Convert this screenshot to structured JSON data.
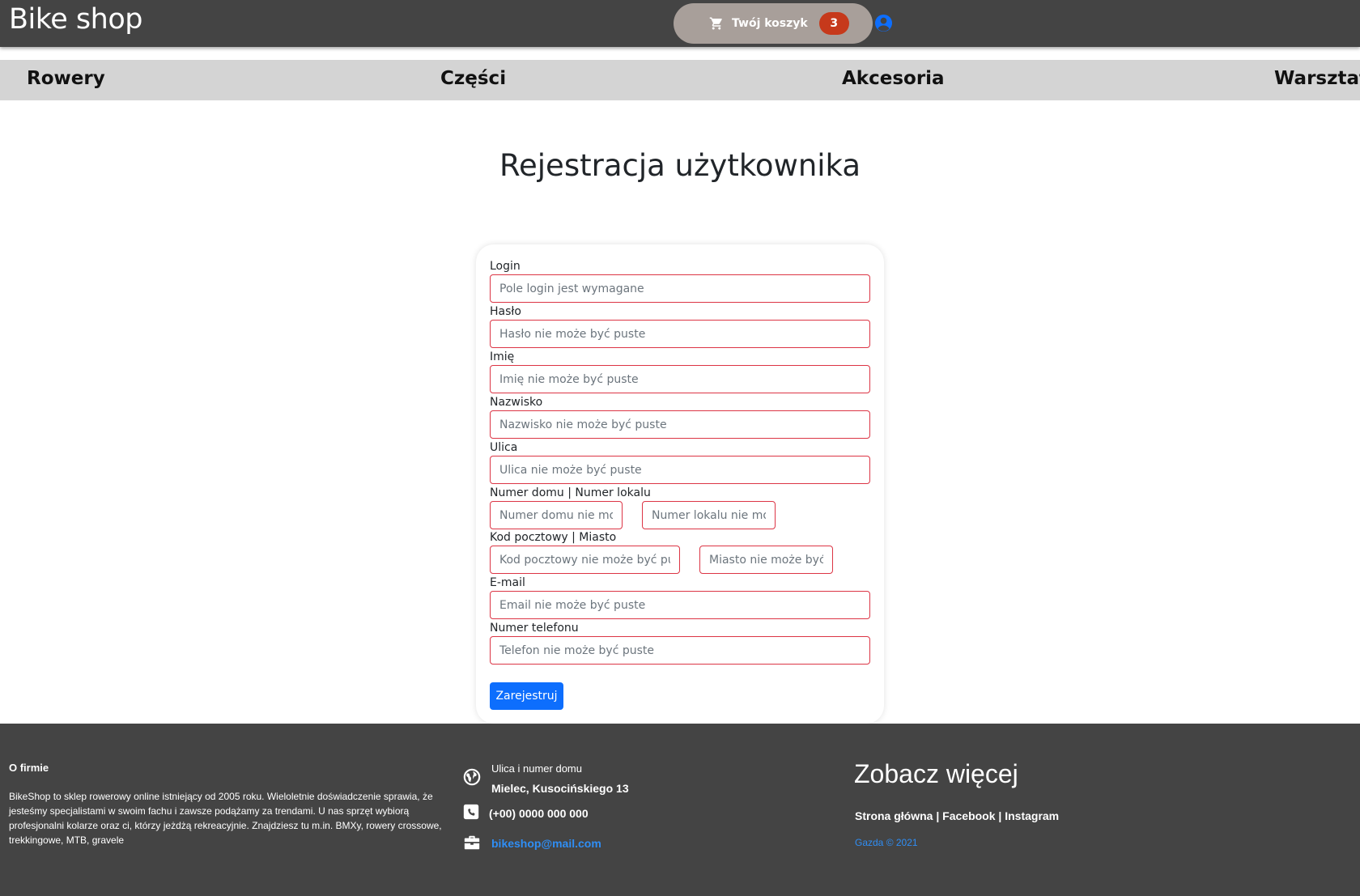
{
  "header": {
    "brand": "Bike shop",
    "cart_label": "Twój koszyk",
    "cart_count": "3"
  },
  "nav": {
    "items": [
      "Rowery",
      "Części",
      "Akcesoria",
      "Warsztat"
    ]
  },
  "main": {
    "title": "Rejestracja użytkownika"
  },
  "form": {
    "login_label": "Login",
    "login_placeholder": "Pole login jest wymagane",
    "password_label": "Hasło",
    "password_placeholder": "Hasło nie może być puste",
    "firstname_label": "Imię",
    "firstname_placeholder": "Imię nie może być puste",
    "lastname_label": "Nazwisko",
    "lastname_placeholder": "Nazwisko nie może być puste",
    "street_label": "Ulica",
    "street_placeholder": "Ulica nie może być puste",
    "house_label": "Numer domu | Numer lokalu",
    "house_placeholder": "Numer domu nie może być puste",
    "apartment_placeholder": "Numer lokalu nie może być puste",
    "postal_label": "Kod pocztowy | Miasto",
    "postal_placeholder": "Kod pocztowy nie może być puste",
    "city_placeholder": "Miasto nie może być puste",
    "email_label": "E-mail",
    "email_placeholder": "Email nie może być puste",
    "phone_label": "Numer telefonu",
    "phone_placeholder": "Telefon nie może być puste",
    "submit_label": "Zarejestruj",
    "error_color": "#dc3545",
    "submit_color": "#0d6efd"
  },
  "footer": {
    "about_title": "O firmie",
    "about_text": "BikeShop to sklep rowerowy online istniejący od 2005 roku. Wieloletnie doświadczenie sprawia, że jesteśmy specjalistami w swoim fachu i zawsze podążamy za trendami. U nas sprzęt wybiorą profesjonalni kolarze oraz ci, którzy jeżdżą rekreacyjnie. Znajdziesz tu m.in. BMXy, rowery crossowe, trekkingowe, MTB, gravele",
    "address_label": "Ulica i numer domu",
    "address": "Mielec, Kusocińskiego 13",
    "phone": "(+00) 0000 000 000",
    "email": "bikeshop@mail.com",
    "more_title": "Zobacz więcej",
    "link_home": "Strona główna",
    "link_facebook": "Facebook",
    "link_instagram": "Instagram",
    "copyright": "Gazda © 2021"
  },
  "icons": {
    "cart": "cart-icon",
    "user": "user-circle-icon",
    "globe": "globe-icon",
    "phone": "phone-icon",
    "briefcase": "briefcase-icon"
  },
  "colors": {
    "header_bg": "#444444",
    "nav_bg": "#d4d4d4",
    "cart_bg": "#a89f9a",
    "badge_bg": "#c6391b",
    "link_blue": "#2f8ef5"
  }
}
